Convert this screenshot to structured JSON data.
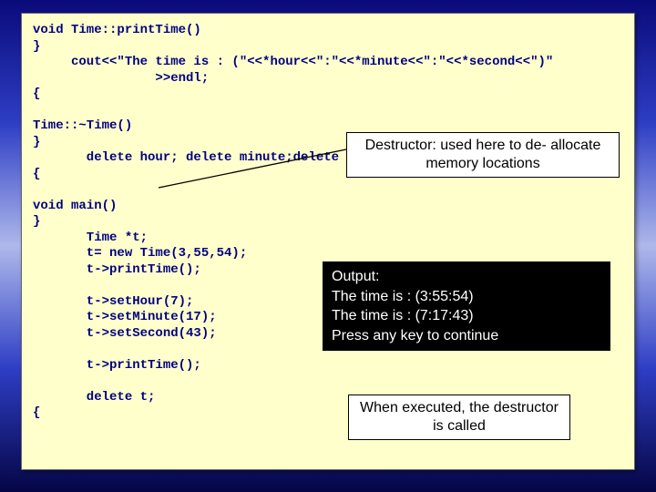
{
  "code_block": "void Time::printTime()\n}\n     cout<<\"The time is : (\"<<*hour<<\":\"<<*minute<<\":\"<<*second<<\")\"\n                >>endl;\n{\n\nTime::~Time()\n}\n       delete hour; delete minute;delete second;\n{\n\nvoid main()\n}\n       Time *t;\n       t= new Time(3,55,54);\n       t->printTime();\n\n       t->setHour(7);\n       t->setMinute(17);\n       t->setSecond(43);\n\n       t->printTime();\n\n       delete t;\n{",
  "callouts": {
    "destructor": "Destructor: used here to de-\nallocate memory locations",
    "executed": "When executed, the\ndestructor is called"
  },
  "output": "Output:\nThe time is : (3:55:54)\nThe time is : (7:17:43)\nPress any key to continue"
}
